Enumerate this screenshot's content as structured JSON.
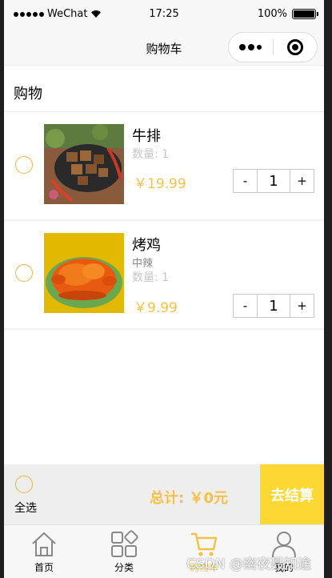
{
  "status_bar": {
    "carrier": "WeChat",
    "time": "17:25",
    "battery": "100%"
  },
  "nav": {
    "title": "购物车"
  },
  "section": {
    "title": "购物"
  },
  "items": [
    {
      "name": "牛排",
      "spec": "",
      "qty_label": "数量: 1",
      "price": "￥19.99",
      "quantity": "1",
      "minus": "-",
      "plus": "+"
    },
    {
      "name": "烤鸡",
      "spec": "中辣",
      "qty_label": "数量: 1",
      "price": "￥9.99",
      "quantity": "1",
      "minus": "-",
      "plus": "+"
    }
  ],
  "checkout": {
    "select_all": "全选",
    "total": "总计: ￥0元",
    "button": "去结算"
  },
  "tabs": [
    {
      "label": "首页",
      "icon": "home-icon"
    },
    {
      "label": "分类",
      "icon": "category-icon"
    },
    {
      "label": "购物车",
      "icon": "cart-icon"
    },
    {
      "label": "我的",
      "icon": "user-icon"
    }
  ],
  "watermark": "CSDN @幽夜聂知途",
  "colors": {
    "accent": "#f5c048",
    "checkout_button": "#fdd835",
    "radio_border": "#f0b43a"
  }
}
